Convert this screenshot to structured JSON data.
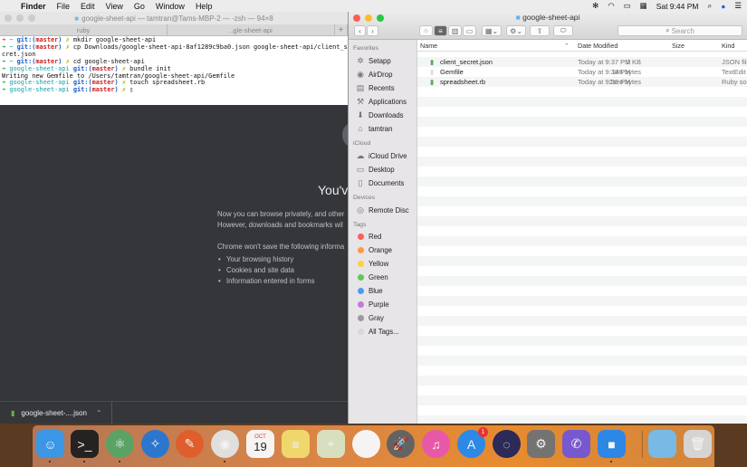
{
  "menubar": {
    "app": "Finder",
    "items": [
      "File",
      "Edit",
      "View",
      "Go",
      "Window",
      "Help"
    ],
    "clock": "Sat 9:44 PM"
  },
  "terminal": {
    "title": "google-sheet-api — tamtran@Tams-MBP-2 — -zsh — 94×8",
    "tabs": [
      "ruby",
      "..gle-sheet-api"
    ],
    "lines": [
      {
        "prompt": "~",
        "cmd": "mkdir google-sheet-api"
      },
      {
        "prompt": "~",
        "cmd": "cp Downloads/google-sheet-api-8af1289c9ba0.json google-sheet-api/client_se"
      },
      {
        "plain": "cret.json"
      },
      {
        "prompt": "~",
        "cmd": "cd google-sheet-api"
      },
      {
        "prompt": "google-sheet-api",
        "cmd": "bundle init"
      },
      {
        "plain": "Writing new Gemfile to /Users/tamtran/google-sheet-api/Gemfile"
      },
      {
        "prompt": "google-sheet-api",
        "cmd": "touch spreadsheet.rb"
      },
      {
        "prompt": "google-sheet-api",
        "cmd": ""
      }
    ],
    "git_label": "git:(",
    "branch": "master",
    "git_close": ")",
    "x": "✗"
  },
  "chrome": {
    "heading": "You'v",
    "p1": "Now you can browse privately, and other",
    "p2": "However, downloads and bookmarks wil",
    "p3": "Chrome won't save the following informa",
    "bullets": [
      "Your browsing history",
      "Cookies and site data",
      "Information entered in forms"
    ],
    "download": "google-sheet-....json"
  },
  "finder": {
    "title": "google-sheet-api",
    "search_placeholder": "Search",
    "sidebar": {
      "favorites": "Favorites",
      "fav_items": [
        "Setapp",
        "AirDrop",
        "Recents",
        "Applications",
        "Downloads",
        "tamtran"
      ],
      "icloud": "iCloud",
      "icloud_items": [
        "iCloud Drive",
        "Desktop",
        "Documents"
      ],
      "devices": "Devices",
      "device_items": [
        "Remote Disc"
      ],
      "tags": "Tags",
      "tag_items": [
        {
          "label": "Red",
          "color": "#fc5f57"
        },
        {
          "label": "Orange",
          "color": "#fd9a3c"
        },
        {
          "label": "Yellow",
          "color": "#fdd23c"
        },
        {
          "label": "Green",
          "color": "#5fc85a"
        },
        {
          "label": "Blue",
          "color": "#4a9cf5"
        },
        {
          "label": "Purple",
          "color": "#c27ad8"
        },
        {
          "label": "Gray",
          "color": "#9a9a9a"
        },
        {
          "label": "All Tags...",
          "color": "#d8d8d8"
        }
      ]
    },
    "columns": {
      "name": "Name",
      "date": "Date Modified",
      "size": "Size",
      "kind": "Kind"
    },
    "files": [
      {
        "name": "client_secret.json",
        "date": "Today at 9:37 PM",
        "size": "2 KB",
        "kind": "JSON file"
      },
      {
        "name": "Gemfile",
        "date": "Today at 9:38 PM",
        "size": "146 bytes",
        "kind": "TextEdit"
      },
      {
        "name": "spreadsheet.rb",
        "date": "Today at 9:38 PM",
        "size": "Zero bytes",
        "kind": "Ruby sou"
      }
    ]
  },
  "dock": {
    "calendar_month": "OCT",
    "calendar_day": "19",
    "appstore_badge": "1"
  }
}
